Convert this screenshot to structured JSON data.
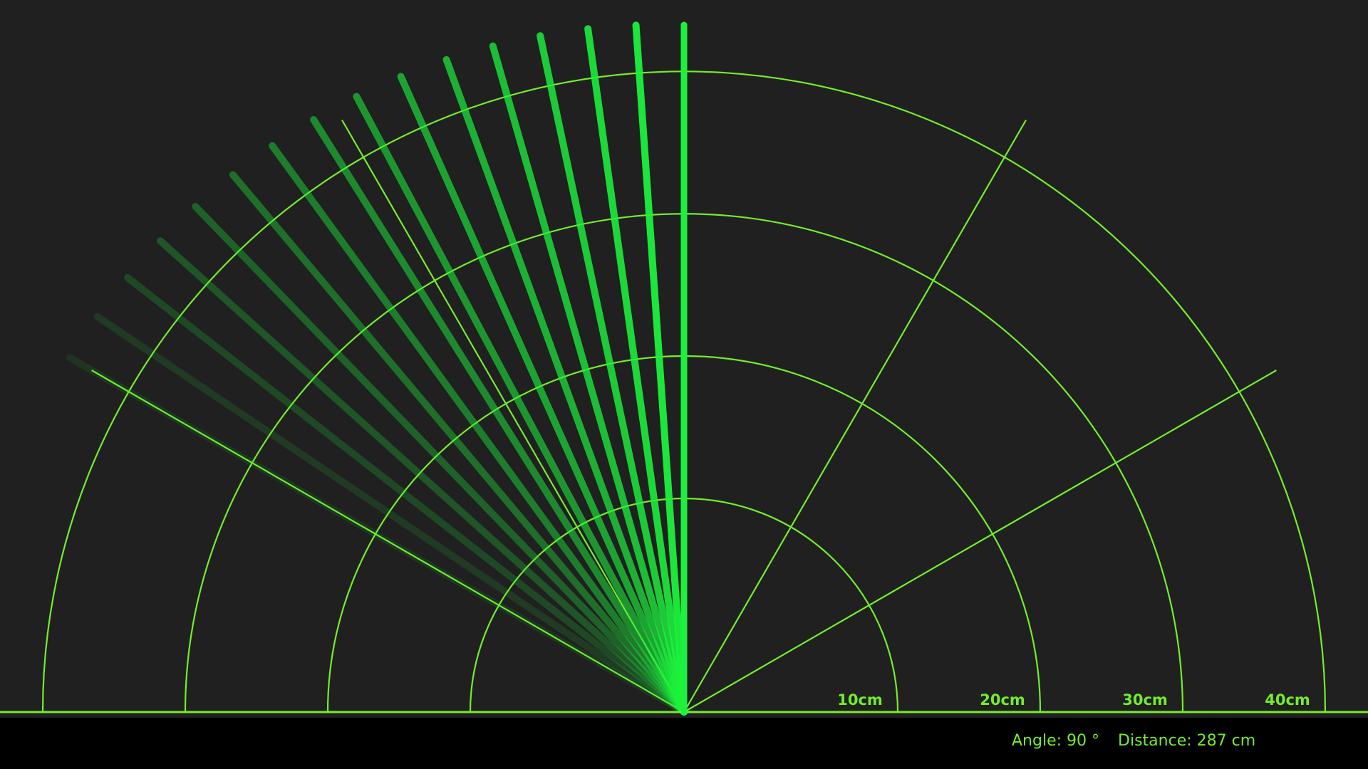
{
  "colors": {
    "background": "#202020",
    "grid": "#74ed2c",
    "sweep": "#1cf23d",
    "status_bar": "#000000"
  },
  "radar": {
    "range_labels": [
      "10cm",
      "20cm",
      "30cm",
      "40cm"
    ],
    "sweep_angle_deg": 90,
    "spoke_angles_deg": [
      30,
      60,
      90,
      120,
      150
    ]
  },
  "status": {
    "angle_label": "Angle:",
    "angle_value": "90",
    "angle_unit": "°",
    "distance_label": "Distance:",
    "distance_value": "287",
    "distance_unit": "cm"
  }
}
